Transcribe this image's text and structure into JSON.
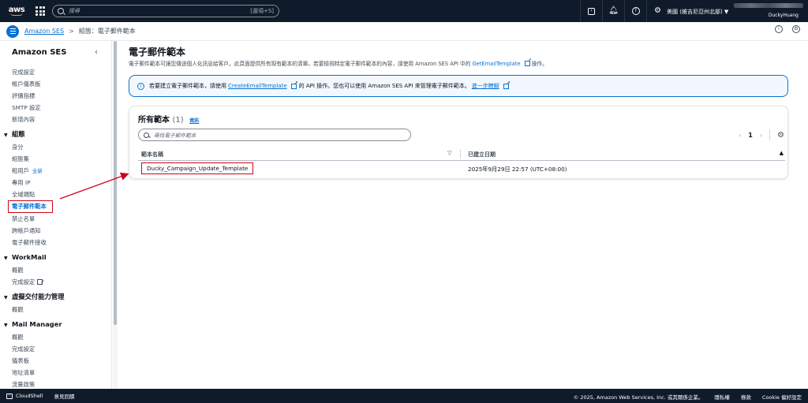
{
  "topnav": {
    "logo_text": "aws",
    "search_placeholder": "搜尋",
    "search_shortcut": "[選項+S]",
    "region": "美國 (維吉尼亞州北部) ▼",
    "username": "DuckyHuang"
  },
  "breadcrumb": {
    "root": "Amazon SES",
    "separator": ">",
    "current": "組態：電子郵件範本"
  },
  "sidebar": {
    "title": "Amazon SES",
    "top_items": [
      "完成設定",
      "帳戶儀表板",
      "評價指標",
      "SMTP 設定",
      "新增內容"
    ],
    "sections": [
      {
        "label": "組態",
        "items": [
          {
            "label": "身分"
          },
          {
            "label": "組態集"
          },
          {
            "label": "租用戶",
            "badge": "全新"
          },
          {
            "label": "專用 IP"
          },
          {
            "label": "全域端點"
          },
          {
            "label": "電子郵件範本",
            "active": true
          },
          {
            "label": "禁止名單"
          },
          {
            "label": "跨帳戶通知"
          },
          {
            "label": "電子郵件接收"
          }
        ]
      },
      {
        "label": "WorkMail",
        "items": [
          {
            "label": "概觀"
          },
          {
            "label": "完成設定",
            "external": true
          }
        ]
      },
      {
        "label": "虛擬交付能力管理",
        "items": [
          {
            "label": "概觀"
          }
        ]
      },
      {
        "label": "Mail Manager",
        "items": [
          {
            "label": "概觀"
          },
          {
            "label": "完成設定"
          },
          {
            "label": "儀表板"
          },
          {
            "label": "地址清單"
          },
          {
            "label": "流量政策"
          }
        ]
      }
    ]
  },
  "main": {
    "title": "電子郵件範本",
    "description_prefix": "電子郵件範本可讓您傳送個人化訊息給客戶。此頁面提供所有現有範本的清單。若要檢視特定電子郵件範本的內容，請使用 Amazon SES API 中的",
    "description_link": "GetEmailTemplate",
    "description_suffix": "操作。",
    "alert_prefix": "若要建立電子郵件範本，請使用",
    "alert_link1": "CreateEmailTemplate",
    "alert_middle": "的 API 操作。您也可以使用 Amazon SES API 來管理電子郵件範本。",
    "alert_link2": "進一步瞭解"
  },
  "panel": {
    "title": "所有範本",
    "count": "(1)",
    "info": "資訊",
    "filter_placeholder": "尋找電子郵件範本",
    "page": "1",
    "columns": [
      "範本名稱",
      "已建立日期"
    ],
    "rows": [
      {
        "name": "Ducky_Campaign_Update_Template",
        "created": "2025年9月29日 22:57 (UTC+08:00)"
      }
    ]
  },
  "footer": {
    "cloudshell": "CloudShell",
    "feedback": "意見回饋",
    "copyright": "© 2025, Amazon Web Services, Inc. 或其關係企業。",
    "privacy": "隱私權",
    "terms": "條款",
    "cookies": "Cookie 偏好設定"
  },
  "colors": {
    "nav_bg": "#0f1b2a",
    "link": "#0972d3",
    "annotation_red": "#d0021b"
  }
}
